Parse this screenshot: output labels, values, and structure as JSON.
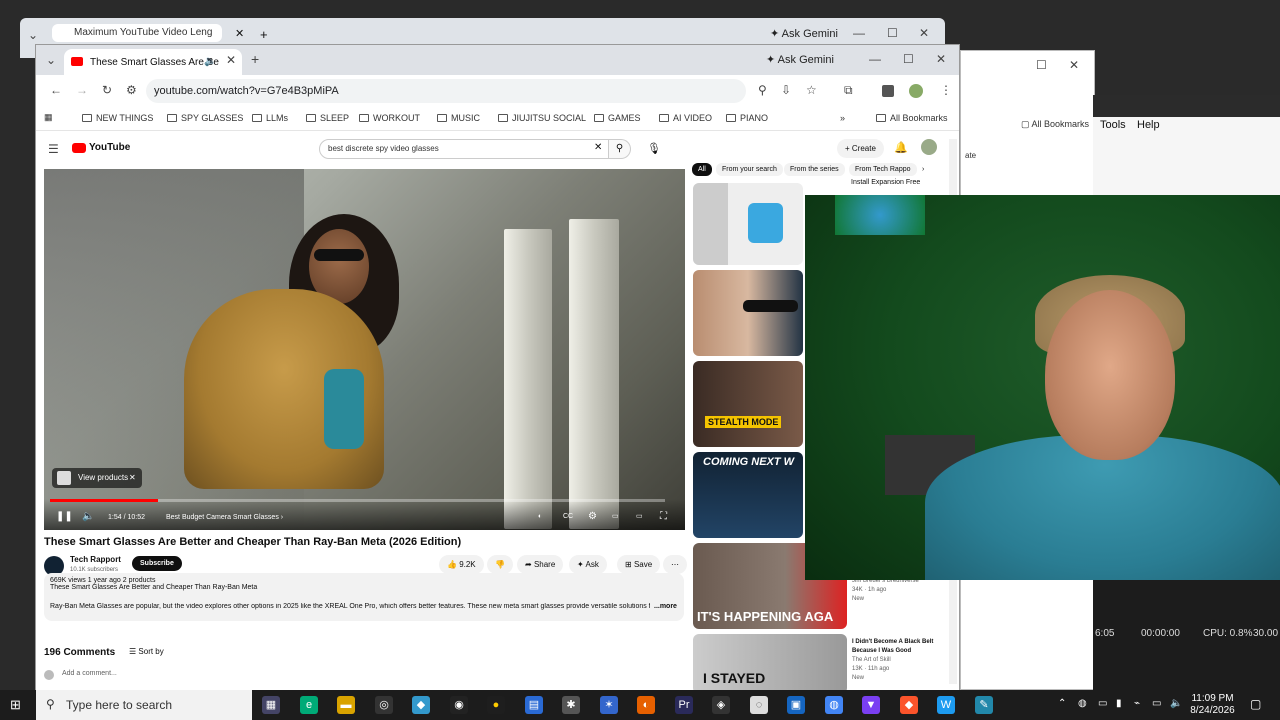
{
  "back_window": {
    "tab_title": "Maximum YouTube Video Leng",
    "ask_gemini": "Ask Gemini"
  },
  "right_window": {
    "menu_tools": "Tools",
    "menu_help": "Help",
    "all_bookmarks": "All Bookmarks",
    "tab_frag": "ate"
  },
  "obs": {
    "time1": "6:05",
    "time2": "00:00:00",
    "cpu": "CPU: 0.8%",
    "fps": "30.00"
  },
  "browser": {
    "tab_title": "These Smart Glasses Are Be",
    "ask_gemini": "Ask Gemini",
    "url": "youtube.com/watch?v=G7e4B3pMiPA",
    "bookmarks": [
      "NEW THINGS",
      "SPY GLASSES",
      "LLMs",
      "SLEEP",
      "WORKOUT",
      "MUSIC",
      "JIUJITSU SOCIAL",
      "GAMES",
      "AI VIDEO",
      "PIANO"
    ],
    "all_bookmarks": "All Bookmarks"
  },
  "youtube": {
    "logo": "YouTube",
    "search_query": "best discrete spy video glasses",
    "create": "Create",
    "player": {
      "time": "1:54 / 10:52",
      "chapter": "Best Budget Camera Smart Glasses",
      "view_products": "View products",
      "progress_fraction": 0.175
    },
    "video_title": "These Smart Glasses Are Better and Cheaper Than Ray-Ban Meta (2026 Edition)",
    "channel": {
      "name": "Tech Rapport",
      "subs": "10.1K subscribers",
      "subscribe": "Subscribe"
    },
    "actions": {
      "likes": "9.2K",
      "share": "Share",
      "ask": "Ask",
      "save": "Save"
    },
    "description": {
      "meta": "669K views  1 year ago  2 products",
      "title": "These Smart Glasses Are Better and Cheaper Than Ray-Ban Meta",
      "body": "Ray-Ban Meta Glasses are popular, but the video explores other options in 2025 like the XREAL One Pro, which offers better features. These new meta smart glasses provide versatile solutions for",
      "more": "...more"
    },
    "comments": {
      "count": "196 Comments",
      "sort": "Sort by",
      "add": "Add a comment..."
    },
    "chips": [
      "All",
      "From your search",
      "From the series",
      "From Tech Rappo"
    ],
    "sidebar": {
      "ad_text": "Install Expansion Free",
      "thumb_stealth": "STEALTH MODE",
      "thumb_coming": "COMING NEXT W",
      "thumb_happening": "IT'S HAPPENING AGA",
      "thumb_stayed": "I STAYED",
      "item4": {
        "channel": "Jim Breuer's Breuniverse",
        "meta": "34K · 1h ago",
        "badge": "New"
      },
      "item5": {
        "title": "I Didn't Become A Black Belt Because I Was Good",
        "channel": "The Art of Skill",
        "meta": "13K · 11h ago",
        "badge": "New"
      }
    }
  },
  "taskbar": {
    "search_placeholder": "Type here to search",
    "time": "11:09 PM",
    "date": "8/24/2026"
  }
}
